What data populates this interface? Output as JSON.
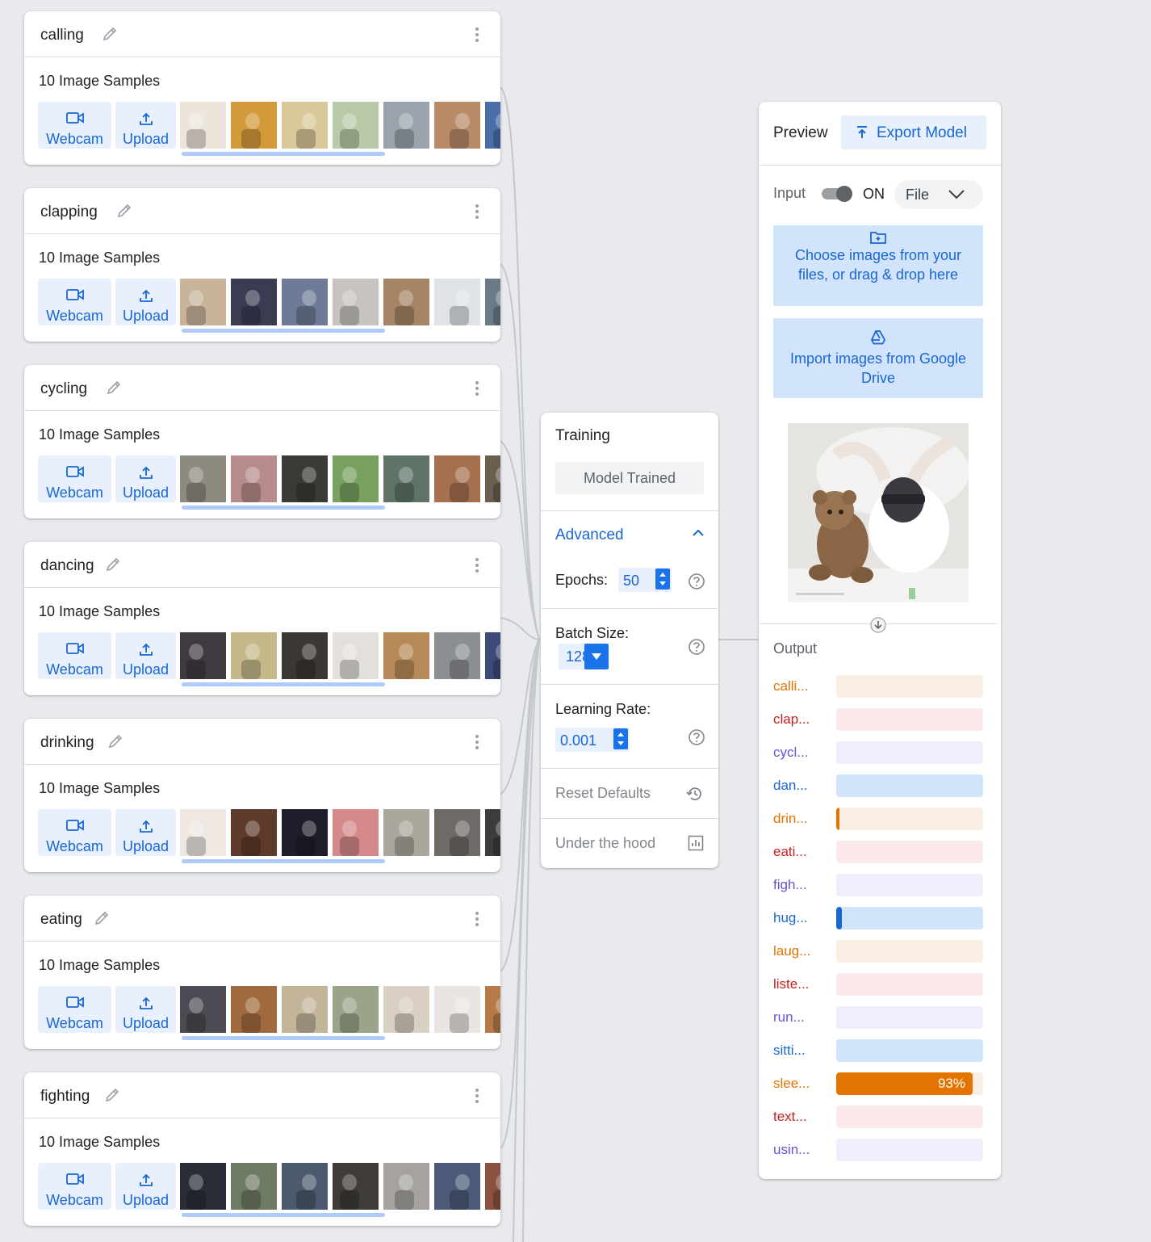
{
  "classes": [
    {
      "name": "calling",
      "samples": "10 Image Samples",
      "webcam": "Webcam",
      "upload": "Upload"
    },
    {
      "name": "clapping",
      "samples": "10 Image Samples",
      "webcam": "Webcam",
      "upload": "Upload"
    },
    {
      "name": "cycling",
      "samples": "10 Image Samples",
      "webcam": "Webcam",
      "upload": "Upload"
    },
    {
      "name": "dancing",
      "samples": "10 Image Samples",
      "webcam": "Webcam",
      "upload": "Upload"
    },
    {
      "name": "drinking",
      "samples": "10 Image Samples",
      "webcam": "Webcam",
      "upload": "Upload"
    },
    {
      "name": "eating",
      "samples": "10 Image Samples",
      "webcam": "Webcam",
      "upload": "Upload"
    },
    {
      "name": "fighting",
      "samples": "10 Image Samples",
      "webcam": "Webcam",
      "upload": "Upload"
    }
  ],
  "training": {
    "title": "Training",
    "status": "Model Trained",
    "advanced": "Advanced",
    "epochs_label": "Epochs:",
    "epochs": "50",
    "batch_label": "Batch Size:",
    "batch": "128",
    "lr_label": "Learning Rate:",
    "lr": "0.001",
    "reset": "Reset Defaults",
    "under_hood": "Under the hood"
  },
  "preview": {
    "title": "Preview",
    "export": "Export Model",
    "input_label": "Input",
    "toggle_state": "ON",
    "source": "File",
    "choose_files": "Choose images from your files, or drag & drop here",
    "import_drive": "Import images from Google Drive",
    "output_label": "Output",
    "outputs": [
      {
        "label": "calli...",
        "percent": 0,
        "color": "#e37400",
        "track": "#fbeee3"
      },
      {
        "label": "clap...",
        "percent": 0,
        "color": "#c5221f",
        "track": "#fbe9eb"
      },
      {
        "label": "cycl...",
        "percent": 0,
        "color": "#6b4fd8",
        "track": "#eeeefd"
      },
      {
        "label": "dan...",
        "percent": 0,
        "color": "#1967d2",
        "track": "#d2e3fc"
      },
      {
        "label": "drin...",
        "percent": 1,
        "color": "#e37400",
        "track": "#fbeee3"
      },
      {
        "label": "eati...",
        "percent": 0,
        "color": "#c5221f",
        "track": "#fbe9eb"
      },
      {
        "label": "figh...",
        "percent": 0,
        "color": "#6b4fd8",
        "track": "#eeeefd"
      },
      {
        "label": "hug...",
        "percent": 4,
        "color": "#1967d2",
        "track": "#d2e3fc"
      },
      {
        "label": "laug...",
        "percent": 0,
        "color": "#e37400",
        "track": "#fbeee3"
      },
      {
        "label": "liste...",
        "percent": 0,
        "color": "#c5221f",
        "track": "#fbe9eb"
      },
      {
        "label": "run...",
        "percent": 0,
        "color": "#6b4fd8",
        "track": "#eeeefd"
      },
      {
        "label": "sitti...",
        "percent": 0,
        "color": "#1967d2",
        "track": "#d2e3fc"
      },
      {
        "label": "slee...",
        "percent": 93,
        "pct_text": "93%",
        "color": "#e37400",
        "track": "#fbeee3"
      },
      {
        "label": "text...",
        "percent": 0,
        "color": "#c5221f",
        "track": "#fbe9eb"
      },
      {
        "label": "usin...",
        "percent": 0,
        "color": "#6b4fd8",
        "track": "#eeeefd"
      }
    ]
  },
  "icons": {
    "edit": "pencil-icon",
    "menu": "more-vert-icon",
    "webcam": "videocam-icon",
    "upload": "upload-icon",
    "export": "export-icon",
    "help": "help-icon",
    "reset": "history-icon",
    "hood": "bar-chart-icon"
  }
}
